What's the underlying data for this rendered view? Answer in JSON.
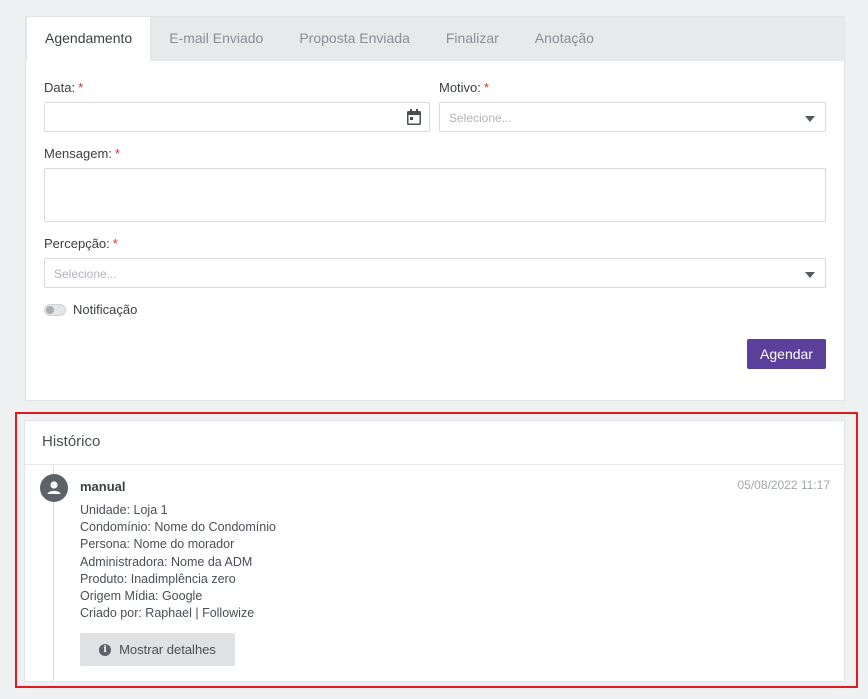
{
  "tabs": [
    {
      "label": "Agendamento",
      "active": true
    },
    {
      "label": "E-mail Enviado",
      "active": false
    },
    {
      "label": "Proposta Enviada",
      "active": false
    },
    {
      "label": "Finalizar",
      "active": false
    },
    {
      "label": "Anotação",
      "active": false
    }
  ],
  "form": {
    "required_mark": "*",
    "data_label": "Data:",
    "data_value": "",
    "motivo_label": "Motivo:",
    "motivo_placeholder": "Selecione...",
    "mensagem_label": "Mensagem:",
    "mensagem_value": "",
    "percepcao_label": "Percepção:",
    "percepcao_placeholder": "Selecione...",
    "notificacao_label": "Notificação",
    "notificacao_on": false,
    "submit_label": "Agendar"
  },
  "history": {
    "title": "Histórico",
    "entry": {
      "title": "manual",
      "timestamp": "05/08/2022 11:17",
      "lines": [
        "Unidade: Loja 1",
        "Condomínio: Nome do Condomínio",
        "Persona: Nome do morador",
        "Administradora: Nome da ADM",
        "Produto: Inadimplência zero",
        "Origem Mídia: Google",
        "Criado por: Raphael | Followize"
      ],
      "details_label": "Mostrar detalhes",
      "info_glyph": "i"
    }
  },
  "colors": {
    "primary": "#5b3f9a",
    "required": "#d0342c",
    "highlight_border": "#e01b1b"
  },
  "icons": {
    "date": "calendar-icon",
    "select": "caret-down-icon",
    "avatar": "user-icon",
    "details": "info-icon"
  }
}
